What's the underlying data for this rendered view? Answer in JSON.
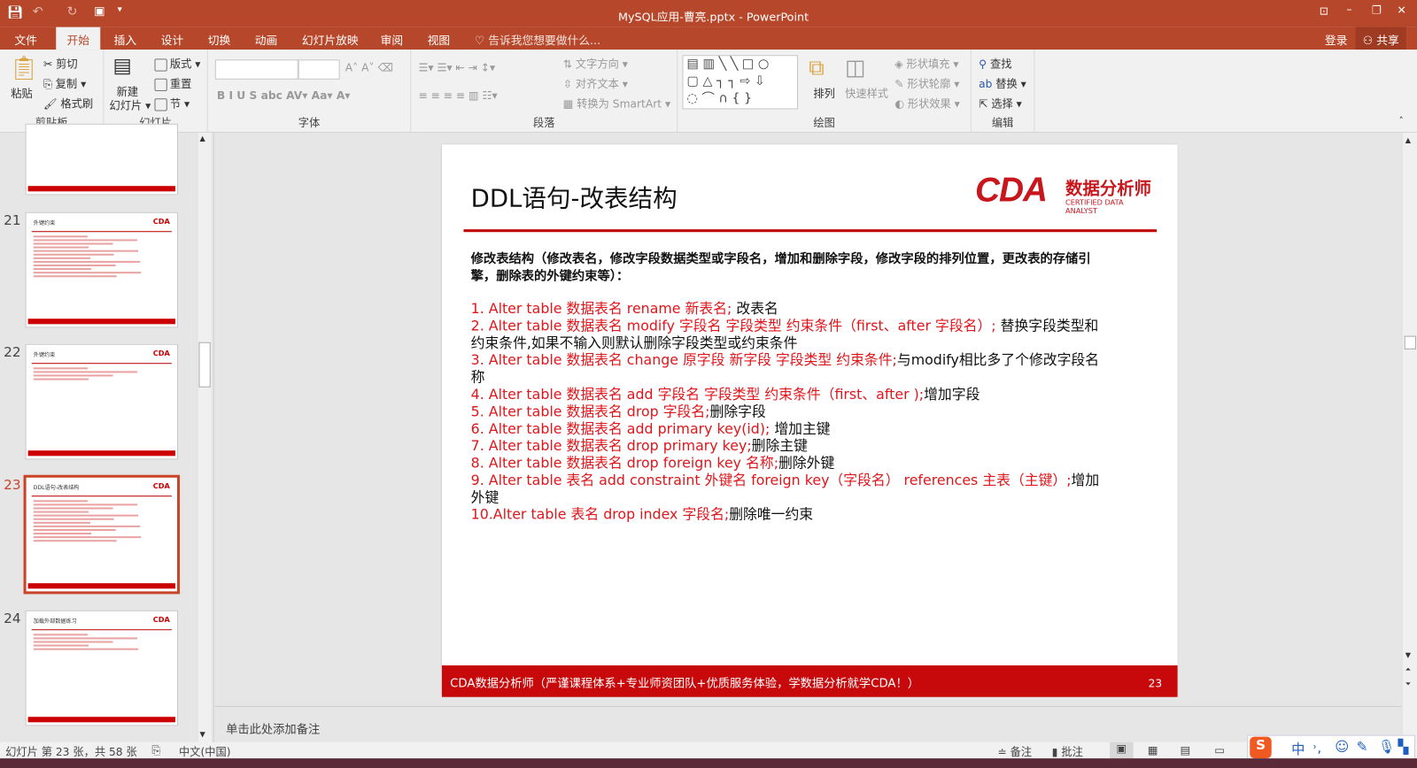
{
  "window": {
    "title": "MySQL应用-曹亮.pptx - PowerPoint"
  },
  "tabs": [
    "文件",
    "开始",
    "插入",
    "设计",
    "切换",
    "动画",
    "幻灯片放映",
    "审阅",
    "视图"
  ],
  "tell_me": "告诉我您想要做什么...",
  "account": {
    "login": "登录",
    "share": "共享"
  },
  "ribbon": {
    "clipboard": {
      "label": "剪贴板",
      "paste": "粘贴",
      "cut": "剪切",
      "copy": "复制",
      "format_painter": "格式刷"
    },
    "slides": {
      "label": "幻灯片",
      "new_slide_1": "新建",
      "new_slide_2": "幻灯片",
      "layout": "版式",
      "reset": "重置",
      "section": "节"
    },
    "font": {
      "label": "字体"
    },
    "paragraph": {
      "label": "段落",
      "text_direction": "文字方向",
      "align_text": "对齐文本",
      "smartart": "转换为 SmartArt"
    },
    "drawing": {
      "label": "绘图",
      "arrange": "排列",
      "quick_styles": "快速样式",
      "fill": "形状填充",
      "outline": "形状轮廓",
      "effects": "形状效果"
    },
    "editing": {
      "label": "编辑",
      "find": "查找",
      "replace": "替换",
      "select": "选择"
    }
  },
  "thumbnails": [
    {
      "num": "21",
      "title": "外键约束",
      "selected": false
    },
    {
      "num": "22",
      "title": "外键约束",
      "selected": false
    },
    {
      "num": "23",
      "title": "DDL语句-改表结构",
      "selected": true
    },
    {
      "num": "24",
      "title": "加载外部数据练习",
      "selected": false
    }
  ],
  "slide": {
    "title": "DDL语句-改表结构",
    "logo": {
      "main": "CDA",
      "cn": "数据分析师",
      "en": "CERTIFIED DATA ANALYST"
    },
    "intro": "修改表结构（修改表名，修改字段数据类型或字段名，增加和删除字段，修改字段的排列位置，更改表的存储引擎，删除表的外键约束等）：",
    "items": [
      {
        "red": "1. Alter table 数据表名 rename  新表名;",
        "black": "     改表名"
      },
      {
        "red": "2. Alter table 数据表名 modify  字段名  字段类型 约束条件（first、after 字段名）;",
        "black": "  替换字段类型和约束条件,如果不输入则默认删除字段类型或约束条件"
      },
      {
        "red": "3. Alter table 数据表名 change 原字段  新字段 字段类型 约束条件;",
        "black": "与modify相比多了个修改字段名称"
      },
      {
        "red": "4. Alter table 数据表名 add  字段名 字段类型 约束条件（first、after );",
        "black": "增加字段"
      },
      {
        "red": "5. Alter table 数据表名 drop 字段名;",
        "black": "删除字段"
      },
      {
        "red": "6. Alter table 数据表名 add primary key(id);",
        "black": " 增加主键"
      },
      {
        "red": "7. Alter table 数据表名 drop primary key;",
        "black": "删除主键"
      },
      {
        "red": "8. Alter table 数据表名 drop foreign key 名称;",
        "black": "删除外键"
      },
      {
        "red": "9. Alter table 表名 add constraint 外键名 foreign key（字段名） references 主表（主键）;",
        "black": "增加外键"
      },
      {
        "red": "10.Alter table 表名 drop index 字段名;",
        "black": "删除唯一约束"
      }
    ],
    "footer": "CDA数据分析师（严谨课程体系+专业师资团队+优质服务体验，学数据分析就学CDA！）",
    "page": "23"
  },
  "notes_placeholder": "单击此处添加备注",
  "status": {
    "slide_info": "幻灯片 第 23 张，共 58 张",
    "language": "中文(中国)",
    "notes": "备注",
    "comments": "批注"
  },
  "ime": {
    "lang": "中"
  }
}
